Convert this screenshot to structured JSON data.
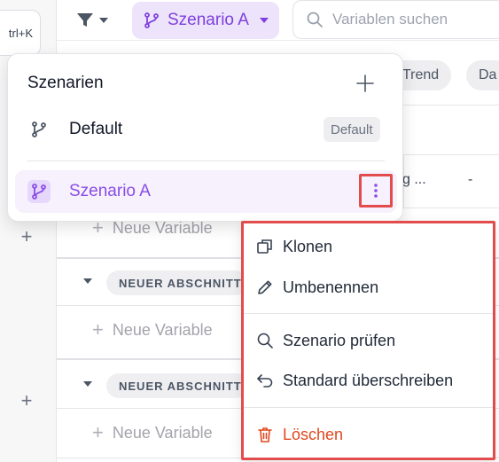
{
  "toolbar": {
    "shortcut_hint": "trl+K",
    "scenario_selected": "Szenario A",
    "search_placeholder": "Variablen suchen"
  },
  "chips": [
    {
      "label": "Trend"
    },
    {
      "label": "Da"
    }
  ],
  "table": {
    "cell_text": "g ...",
    "cell_value": "-",
    "new_variable_label": "Neue Variable",
    "sections": [
      {
        "label": "NEUER ABSCHNITT"
      },
      {
        "label": "NEUER ABSCHNITT"
      }
    ]
  },
  "scenario_popover": {
    "title": "Szenarien",
    "items": [
      {
        "label": "Default",
        "tag": "Default"
      },
      {
        "label": "Szenario A"
      }
    ]
  },
  "context_menu": {
    "items": [
      {
        "label": "Klonen",
        "icon": "clone-icon"
      },
      {
        "label": "Umbenennen",
        "icon": "pencil-icon"
      },
      {
        "label": "Szenario prüfen",
        "icon": "search-icon"
      },
      {
        "label": "Standard überschreiben",
        "icon": "undo-icon"
      },
      {
        "label": "Löschen",
        "icon": "trash-icon"
      }
    ]
  },
  "colors": {
    "accent": "#8a4de6",
    "accent_bg": "#ede4fb",
    "danger": "#e0481f",
    "highlight_border": "#e24c4c"
  }
}
